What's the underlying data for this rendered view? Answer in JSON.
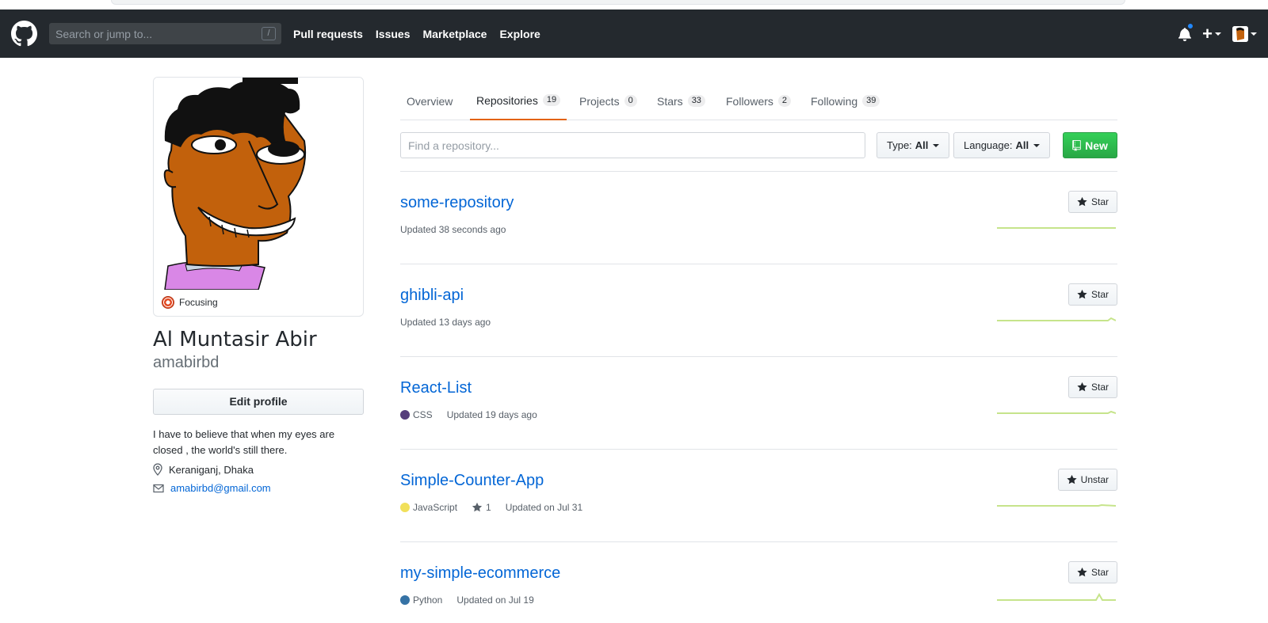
{
  "header": {
    "search_placeholder": "Search or jump to...",
    "search_shortcut": "/",
    "nav": [
      "Pull requests",
      "Issues",
      "Marketplace",
      "Explore"
    ],
    "plus_label": "+"
  },
  "profile": {
    "status": "Focusing",
    "full_name": "Al Muntasir Abir",
    "username": "amabirbd",
    "edit_label": "Edit profile",
    "bio": "I have to believe that when my eyes are closed , the world's still there.",
    "location": "Keraniganj, Dhaka",
    "email": "amabirbd@gmail.com"
  },
  "tabs": [
    {
      "label": "Overview",
      "count": ""
    },
    {
      "label": "Repositories",
      "count": "19"
    },
    {
      "label": "Projects",
      "count": "0"
    },
    {
      "label": "Stars",
      "count": "33"
    },
    {
      "label": "Followers",
      "count": "2"
    },
    {
      "label": "Following",
      "count": "39"
    }
  ],
  "filters": {
    "find_placeholder": "Find a repository...",
    "type_label": "Type:",
    "type_value": "All",
    "language_label": "Language:",
    "language_value": "All",
    "new_label": "New"
  },
  "repos": [
    {
      "name": "some-repository",
      "language": "",
      "language_color": "",
      "stars": "",
      "updated": "Updated 38 seconds ago",
      "button": "Star"
    },
    {
      "name": "ghibli-api",
      "language": "",
      "language_color": "",
      "stars": "",
      "updated": "Updated 13 days ago",
      "button": "Star"
    },
    {
      "name": "React-List",
      "language": "CSS",
      "language_color": "#563d7c",
      "stars": "",
      "updated": "Updated 19 days ago",
      "button": "Star"
    },
    {
      "name": "Simple-Counter-App",
      "language": "JavaScript",
      "language_color": "#f1e05a",
      "stars": "1",
      "updated": "Updated on Jul 31",
      "button": "Unstar"
    },
    {
      "name": "my-simple-ecommerce",
      "language": "Python",
      "language_color": "#3572A5",
      "stars": "",
      "updated": "Updated on Jul 19",
      "button": "Star"
    }
  ],
  "colors": {
    "header_bg": "#24292e",
    "link": "#0366d6",
    "active_tab": "#e36209",
    "new_button": "#28a745",
    "sparkline": "#c6e48b"
  }
}
